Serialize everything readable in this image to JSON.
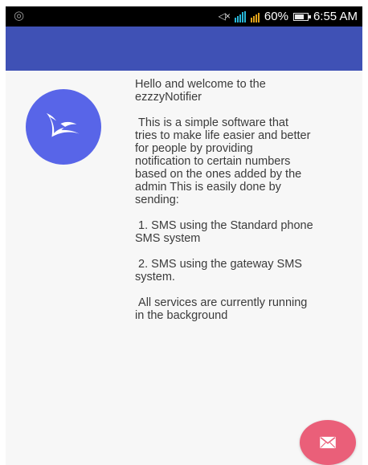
{
  "status": {
    "left_icon": "circle-status-icon",
    "battery": "60%",
    "time": "6:55 AM"
  },
  "content": {
    "paragraphs": [
      "Hello and welcome to the\nezzzyNotifier",
      " This is a simple software that\ntries to make life easier and better\nfor people by providing\nnotification to certain numbers\nbased on the ones added by the\nadmin This is easily done by\nsending:",
      " 1. SMS using the Standard phone\nSMS system",
      " 2. SMS using the gateway SMS\nsystem.",
      " All services are currently running\nin the background"
    ]
  },
  "fab": {
    "icon": "mail-icon"
  },
  "colors": {
    "status_bar": "#000000",
    "app_bar": "#3f51b5",
    "avatar": "#5865e8",
    "fab": "#ea5f79",
    "background": "#f7f7f7"
  }
}
